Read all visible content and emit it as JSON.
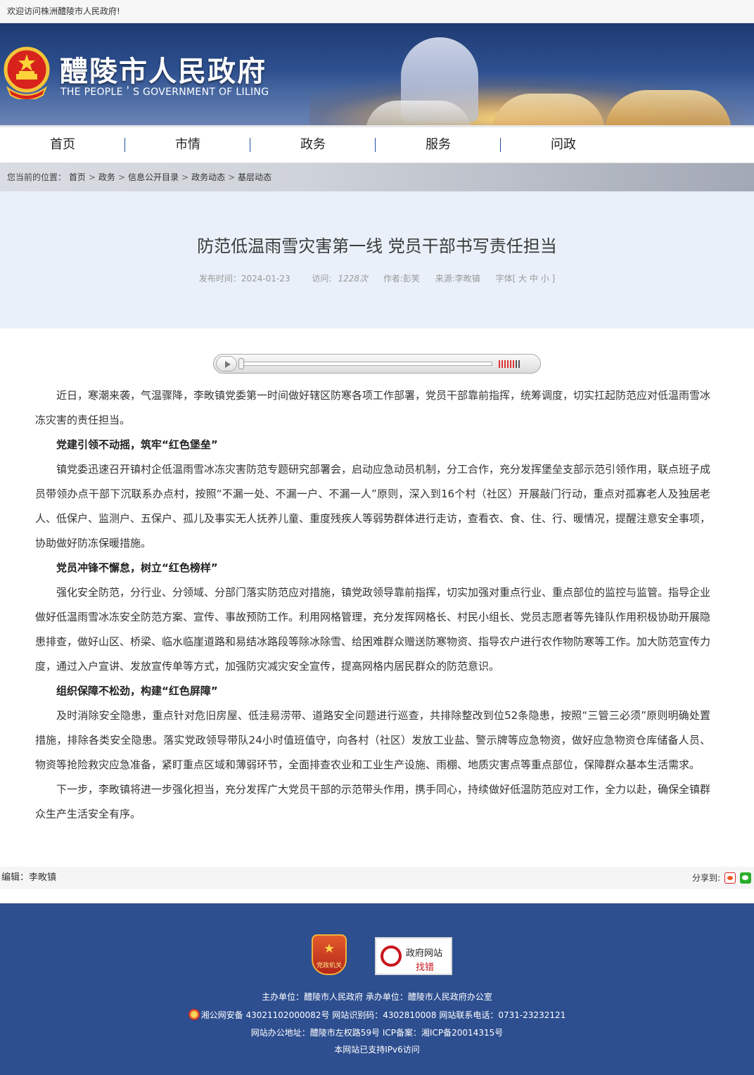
{
  "topbar": {
    "welcome": "欢迎访问株洲醴陵市人民政府!"
  },
  "header": {
    "title_cn": "醴陵市人民政府",
    "title_en": "THE PEOPLE＇S GOVERNMENT OF LILING"
  },
  "nav": {
    "items": [
      "首页",
      "市情",
      "政务",
      "服务",
      "问政"
    ]
  },
  "breadcrumb": {
    "prefix": "您当前的位置：",
    "items": [
      "首页",
      "政务",
      "信息公开目录",
      "政务动态",
      "基层动态"
    ],
    "separator": ">"
  },
  "article": {
    "title": "防范低温雨雪灾害第一线 党员干部书写责任担当",
    "meta": {
      "published": "发布时间：2024-01-23",
      "visits_label": "访问:",
      "visits_value": "1228次",
      "author": "作者:彭笑",
      "source": "来源:李畋镇",
      "font_size": "字体[ 大 中 小 ]"
    },
    "audio": {
      "volume_level": 0.8
    },
    "paragraphs": [
      {
        "type": "p",
        "text": "近日，寒潮来袭，气温骤降，李畋镇党委第一时间做好辖区防寒各项工作部署，党员干部靠前指挥，统筹调度，切实扛起防范应对低温雨雪冰冻灾害的责任担当。"
      },
      {
        "type": "h",
        "text": "党建引领不动摇，筑牢“红色堡垒”"
      },
      {
        "type": "p",
        "text": "镇党委迅速召开镇村企低温雨雪冰冻灾害防范专题研究部署会，启动应急动员机制，分工合作，充分发挥堡垒支部示范引领作用，联点班子成员带领办点干部下沉联系办点村，按照“不漏一处、不漏一户、不漏一人”原则，深入到16个村（社区）开展敲门行动，重点对孤寡老人及独居老人、低保户、监测户、五保户、孤儿及事实无人抚养儿童、重度残疾人等弱势群体进行走访，查看衣、食、住、行、暖情况，提醒注意安全事项，协助做好防冻保暖措施。"
      },
      {
        "type": "h",
        "text": "党员冲锋不懈怠，树立“红色榜样”"
      },
      {
        "type": "p",
        "text": "强化安全防范，分行业、分领域、分部门落实防范应对措施，镇党政领导靠前指挥，切实加强对重点行业、重点部位的监控与监管。指导企业做好低温雨雪冰冻安全防范方案、宣传、事故预防工作。利用网格管理，充分发挥网格长、村民小组长、党员志愿者等先锋队作用积极协助开展隐患排查，做好山区、桥梁、临水临崖道路和易结冰路段等除冰除雪、给困难群众赠送防寒物资、指导农户进行农作物防寒等工作。加大防范宣传力度，通过入户宣讲、发放宣传单等方式，加强防灾减灾安全宣传，提高网格内居民群众的防范意识。"
      },
      {
        "type": "h",
        "text": "组织保障不松劲，构建“红色屏障”"
      },
      {
        "type": "p",
        "text": "及时消除安全隐患，重点针对危旧房屋、低洼易涝带、道路安全问题进行巡查，共排除整改到位52条隐患，按照“三管三必须”原则明确处置措施，排除各类安全隐患。落实党政领导带队24小时值班值守，向各村（社区）发放工业盐、警示牌等应急物资，做好应急物资仓库储备人员、物资等抢险救灾应急准备，紧盯重点区域和薄弱环节，全面排查农业和工业生产设施、雨棚、地质灾害点等重点部位，保障群众基本生活需求。"
      },
      {
        "type": "p",
        "text": "下一步，李畋镇将进一步强化担当，充分发挥广大党员干部的示范带头作用，携手同心，持续做好低温防范应对工作，全力以赴，确保全镇群众生产生活安全有序。"
      }
    ],
    "editor": "编辑：李畋镇",
    "share_label": "分享到:"
  },
  "footer": {
    "party_badge_label": "党政机关",
    "error_badge_line1": "政府网站",
    "error_badge_line2": "找错",
    "line1": "主办单位：醴陵市人民政府 承办单位：醴陵市人民政府办公室",
    "line2": "湘公网安备 43021102000082号 网站识别码：4302810008 网站联系电话：0731-23232121",
    "line3": "网站办公地址：醴陵市左权路59号   ICP备案：湘ICP备20014315号",
    "line4": "本网站已支持IPv6访问"
  },
  "colors": {
    "nav_divider": "#1f4f9c",
    "footer_bg": "#2d4e8f",
    "header_bg": "#e9f0f9"
  },
  "icons": [
    "national-emblem-icon",
    "play-icon",
    "weibo-icon",
    "wechat-icon",
    "party-badge-icon",
    "magnifier-icon",
    "police-badge-icon"
  ]
}
